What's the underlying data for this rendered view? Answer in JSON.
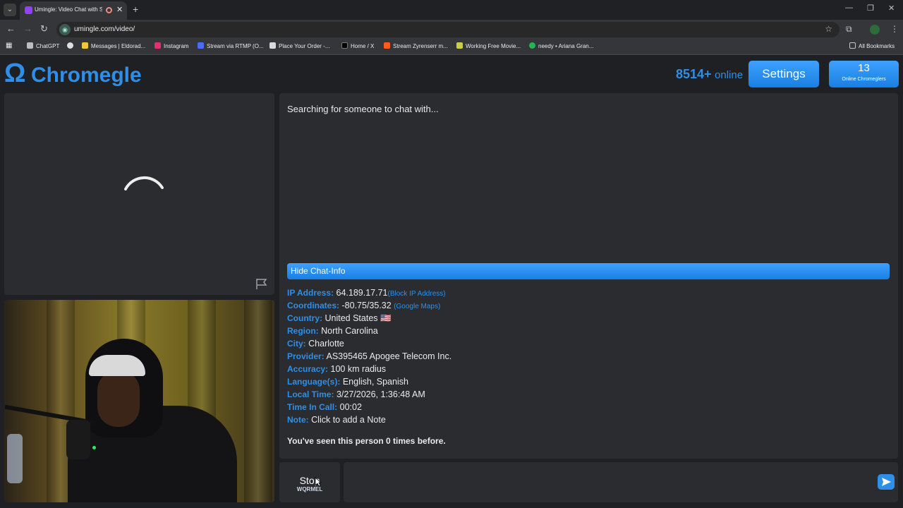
{
  "browser": {
    "tab_title": "Umingle: Video Chat with S",
    "url": "umingle.com/video/",
    "bookmarks": [
      {
        "label": "ChatGPT",
        "color": "#bdbdbd"
      },
      {
        "label": "",
        "color": "#e0e0e0"
      },
      {
        "label": "Messages | Eldorad...",
        "color": "#f5c542"
      },
      {
        "label": "Instagram",
        "color": "#e1306c"
      },
      {
        "label": "Stream via RTMP (O...",
        "color": "#4a6cf7"
      },
      {
        "label": "Place Your Order -...",
        "color": "#d9d9d9"
      },
      {
        "label": "Home / X",
        "color": "#000000"
      },
      {
        "label": "Stream Zyrenserr m...",
        "color": "#ff5a1f"
      },
      {
        "label": "Working Free Movie...",
        "color": "#c8d040"
      },
      {
        "label": "needy • Ariana Gran...",
        "color": "#1db954"
      }
    ],
    "all_bookmarks": "All Bookmarks"
  },
  "header": {
    "logo_text": "Chromegle",
    "online_count": "8514+",
    "online_label": "online",
    "settings_label": "Settings",
    "chromeglers_count": "13",
    "chromeglers_label": "Online Chromeglers"
  },
  "chat": {
    "status": "Searching for someone to chat with...",
    "hide_info_label": "Hide Chat-Info",
    "info": {
      "ip_label": "IP Address:",
      "ip_value": "64.189.17.71",
      "ip_link": "(Block IP Address)",
      "coords_label": "Coordinates:",
      "coords_value": "-80.75/35.32",
      "coords_link": "(Google Maps)",
      "country_label": "Country:",
      "country_value": "United States 🇺🇸",
      "region_label": "Region:",
      "region_value": "North Carolina",
      "city_label": "City:",
      "city_value": "Charlotte",
      "provider_label": "Provider:",
      "provider_value": "AS395465 Apogee Telecom Inc.",
      "accuracy_label": "Accuracy:",
      "accuracy_value": "100 km radius",
      "languages_label": "Language(s):",
      "languages_value": "English, Spanish",
      "localtime_label": "Local Time:",
      "localtime_value": "3/27/2026, 1:36:48 AM",
      "timeincall_label": "Time In Call:",
      "timeincall_value": "00:02",
      "note_label": "Note:",
      "note_value": "Click to add a Note"
    },
    "seen_text": "You've seen this person 0 times before."
  },
  "controls": {
    "stop_label": "Stop",
    "stop_sub": "WQRMEL"
  },
  "colors": {
    "accent": "#2f8fe8",
    "panel": "#2b2c30",
    "background": "#1f2023"
  }
}
